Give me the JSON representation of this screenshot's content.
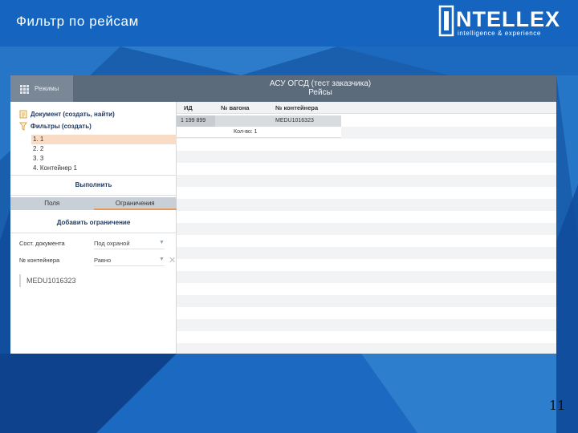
{
  "slide": {
    "title": "Фильтр по рейсам",
    "page_number": "11"
  },
  "logo": {
    "main": "NTELLEX",
    "sub": "intelligence & experience"
  },
  "app": {
    "header": {
      "modes_label": "Режимы",
      "title_line1": "АСУ ОГСД (тест заказчика)",
      "title_line2": "Рейсы"
    },
    "left_panel": {
      "document_label": "Документ (создать, найти)",
      "filters_label": "Фильтры (создать)",
      "filters": [
        "1. 1",
        "2. 2",
        "3. 3",
        "4. Контейнер 1"
      ],
      "selected_filter_index": 0,
      "run_button": "Выполнить",
      "tabs": [
        {
          "label": "Поля",
          "active": false
        },
        {
          "label": "Ограничения",
          "active": true
        }
      ],
      "add_condition": "Добавить ограничение",
      "conditions": [
        {
          "label": "Сост. документа",
          "value": "Под охраной"
        },
        {
          "label": "№ контейнера",
          "value": "Равно"
        }
      ],
      "value_input": "MEDU1016323"
    },
    "table": {
      "columns": [
        "ИД",
        "№ вагона",
        "№ контейнера"
      ],
      "rows": [
        {
          "id": "1 199 899",
          "wagon": "",
          "container": "MEDU1016323"
        }
      ],
      "count_label": "Кол-во: 1"
    }
  },
  "colors": {
    "background": "#1a5fae",
    "header_bar": "#5b6b7b",
    "selected_filter": "#f9dcc6",
    "active_tab_underline": "#e69a5a"
  }
}
